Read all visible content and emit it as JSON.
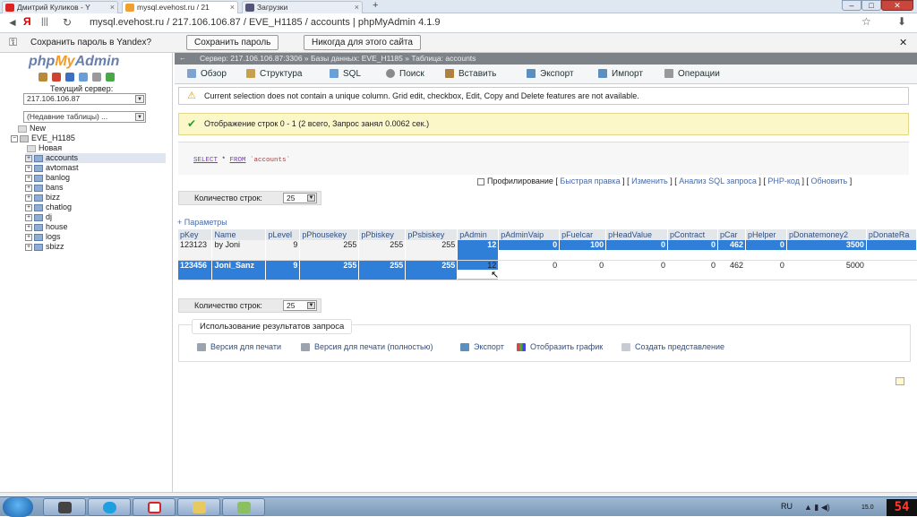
{
  "browser": {
    "tabs": [
      {
        "label": "Дмитрий Куликов - Y",
        "active": false
      },
      {
        "label": "mysql.evehost.ru / 21",
        "active": true
      },
      {
        "label": "Загрузки",
        "active": false
      }
    ],
    "new_tab": "+",
    "address_host": "mysql.evehost.ru",
    "address_rest": "mysql.evehost.ru / 217.106.106.87 / EVE_H1185 / accounts | phpMyAdmin 4.1.9",
    "yandex_glyph": "Я"
  },
  "password_bar": {
    "prompt": "Сохранить пароль в Yandex?",
    "save_label": "Сохранить пароль",
    "never_label": "Никогда для этого сайта"
  },
  "sidebar": {
    "logo_php": "php",
    "logo_my": "My",
    "logo_admin": "Admin",
    "server_label": "Текущий сервер:",
    "server_value": "217.106.106.87",
    "recent_value": "(Недавние таблицы) ...",
    "tree_new": "New",
    "tree_db": "EVE_H1185",
    "tree_new_table": "Новая",
    "tables": [
      "accounts",
      "avtomast",
      "banlog",
      "bans",
      "bizz",
      "chatlog",
      "dj",
      "house",
      "logs",
      "sbizz"
    ],
    "active_table": "accounts"
  },
  "breadcrumb": "Сервер: 217.106.106.87:3306 » Базы данных: EVE_H1185 » Таблица: accounts",
  "menu": {
    "items": [
      "Обзор",
      "Структура",
      "SQL",
      "Поиск",
      "Вставить",
      "Экспорт",
      "Импорт",
      "Операции"
    ]
  },
  "notice": "Current selection does not contain a unique column. Grid edit, checkbox, Edit, Copy and Delete features are not available.",
  "success": "Отображение строк 0 - 1 (2 всего, Запрос занял 0.0062 сек.)",
  "sql": {
    "select": "SELECT",
    "star": " * ",
    "from": "FROM",
    "table": " `accounts`"
  },
  "sql_links": {
    "profiling": "Профилирование",
    "quick_edit": "Быстрая правка",
    "edit": "Изменить",
    "analyze": "Анализ SQL запроса",
    "php_code": "PHP-код",
    "refresh": "Обновить"
  },
  "row_count": {
    "label": "Количество строк:",
    "value": "25"
  },
  "params_label": "+ Параметры",
  "table": {
    "columns": [
      "pKey",
      "Name",
      "pLevel",
      "pPhousekey",
      "pPbiskey",
      "pPsbiskey",
      "pAdmin",
      "pAdminVaip",
      "pFuelcar",
      "pHeadValue",
      "pContract",
      "pCar",
      "pHelper",
      "pDonatemoney2",
      "pDonateRa"
    ],
    "rows": [
      [
        "123123",
        "by Joni",
        "9",
        "255",
        "255",
        "255",
        "12",
        "0",
        "100",
        "0",
        "0",
        "462",
        "0",
        "3500",
        ""
      ],
      [
        "123456",
        "Joni_Sanz",
        "9",
        "255",
        "255",
        "255",
        "12",
        "0",
        "0",
        "0",
        "0",
        "462",
        "0",
        "5000",
        ""
      ]
    ]
  },
  "usage": {
    "title": "Использование результатов запроса",
    "links": [
      "Версия для печати",
      "Версия для печати (полностью)",
      "Экспорт",
      "Отобразить график",
      "Создать представление"
    ]
  },
  "taskbar": {
    "lang": "RU",
    "clock": "15.0",
    "counter": "54"
  },
  "colors": {
    "selection": "#2f7ed8",
    "breadcrumb": "#7d8289",
    "success_bg": "#fbf7c8"
  }
}
